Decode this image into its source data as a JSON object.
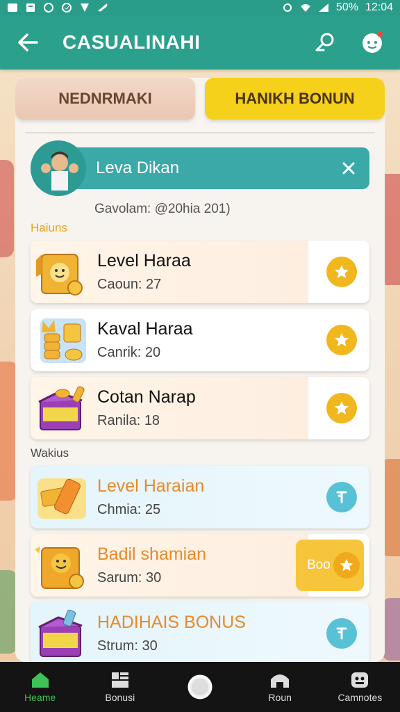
{
  "status_bar": {
    "battery": "50%",
    "time": "12:04"
  },
  "app_bar": {
    "title": "CASUALINAHI"
  },
  "tabs": [
    {
      "label": "NEDNRMAKI",
      "active": false
    },
    {
      "label": "HANIKH BONUN",
      "active": true
    }
  ],
  "user": {
    "name": "Leva Dikan",
    "subtitle": "Gavolam: @20hia 201)"
  },
  "sections": [
    {
      "label": "Haiuns",
      "items": [
        {
          "title": "Level Haraa",
          "subtitle": "Caoun: 27",
          "action": "star"
        },
        {
          "title": "Kaval Haraa",
          "subtitle": "Canrik: 20",
          "action": "star"
        },
        {
          "title": "Cotan Narap",
          "subtitle": "Ranila: 18",
          "action": "star"
        }
      ]
    },
    {
      "label": "Wakius",
      "items": [
        {
          "title": "Level Haraian",
          "subtitle": "Chmia: 25",
          "action": "download"
        },
        {
          "title": "Badil shamian",
          "subtitle": "Sarum: 30",
          "action": "bonus",
          "action_label": "Boo"
        },
        {
          "title": "HADIHAIS BONUS",
          "subtitle": "Strum: 30",
          "action": "download"
        }
      ]
    }
  ],
  "bottom_nav": [
    {
      "label": "Heame",
      "icon": "home-icon",
      "active": true
    },
    {
      "label": "Bonusi",
      "icon": "grid-icon",
      "active": false
    },
    {
      "label": "",
      "icon": "home-circle-icon",
      "active": false
    },
    {
      "label": "Roun",
      "icon": "store-icon",
      "active": false
    },
    {
      "label": "Camnotes",
      "icon": "games-icon",
      "active": false
    }
  ],
  "colors": {
    "primary": "#2ba08c",
    "accent_yellow": "#f6d11b",
    "star": "#f1b71f",
    "download": "#59c1d6",
    "nav_active": "#3cc257"
  }
}
